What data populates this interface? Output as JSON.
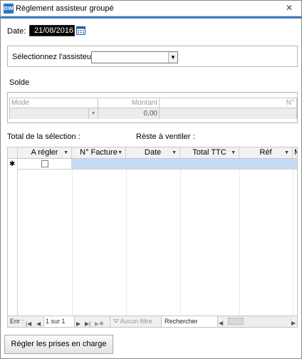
{
  "window": {
    "title": "Règlement assisteur groupé",
    "app_icon_text": "OW",
    "close_glyph": "✕"
  },
  "date": {
    "label": "Date:",
    "value": "21/08/2016"
  },
  "assisteur": {
    "label": "Sélectionnez l'assisteur",
    "value": ""
  },
  "solde": {
    "label": "Solde",
    "columns": [
      "Mode",
      "Montant",
      "N°"
    ],
    "row": {
      "mode": "",
      "montant": "0,00",
      "numero": ""
    }
  },
  "totals": {
    "selection_label": "Total de la sélection :",
    "reste_label": "Rèste à ventiler :"
  },
  "grid": {
    "columns": [
      "A régler",
      "N° Facture",
      "Date",
      "Total TTC",
      "Réf",
      "M"
    ],
    "new_row_marker": "✱"
  },
  "navigator": {
    "record_label": "Enr :",
    "position": "1 sur 1",
    "filter_label": "Aucun filtre",
    "search_label": "Rechercher"
  },
  "actions": {
    "primary_label": "Régler les prises en charge"
  },
  "colors": {
    "accent": "#3f79c1",
    "selected_row": "#c5dcf6",
    "header_bg": "#f2f2f2"
  }
}
